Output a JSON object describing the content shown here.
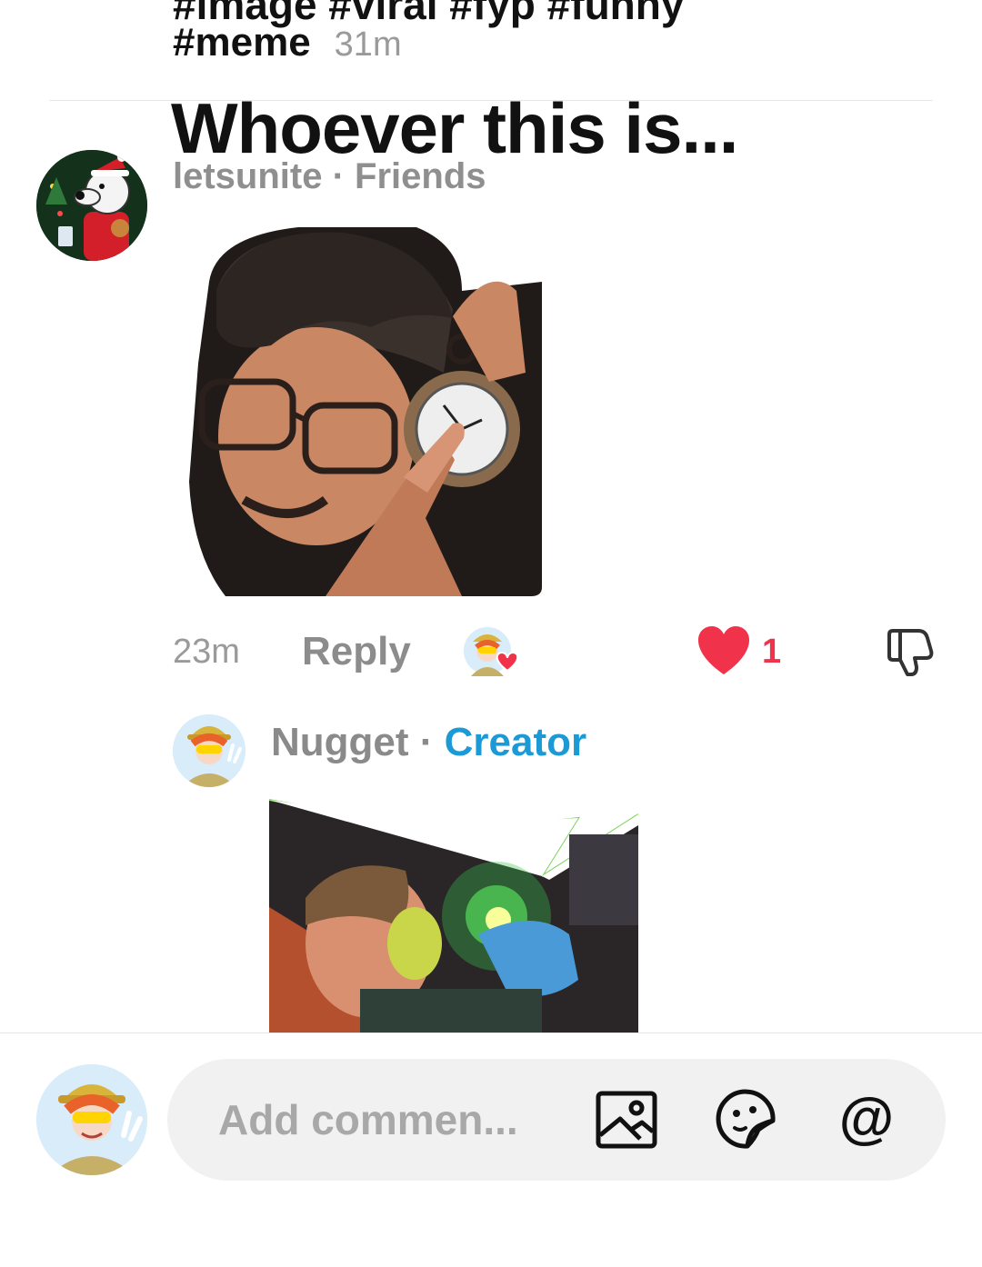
{
  "previous_post": {
    "tags_cut": "#image #viral #fyp #funny",
    "tags": "#meme",
    "time": "31m"
  },
  "comment": {
    "text": "Whoever this is...",
    "author": "letsunite",
    "relation": "Friends",
    "meta_separator": " · ",
    "time": "23m",
    "reply_label": "Reply",
    "like_count": "1"
  },
  "reply": {
    "author": "Nugget",
    "separator": " · ",
    "badge": "Creator"
  },
  "composer": {
    "placeholder": "Add commen...",
    "mention_symbol": "@"
  },
  "icons": {
    "image": "image-icon",
    "sticker": "sticker-icon",
    "mention": "at-sign-icon",
    "like": "heart-icon",
    "dislike": "thumbs-down-icon"
  },
  "colors": {
    "like": "#f0334a",
    "creator_badge": "#1c9ad6",
    "muted_text": "#8f8f8f"
  }
}
